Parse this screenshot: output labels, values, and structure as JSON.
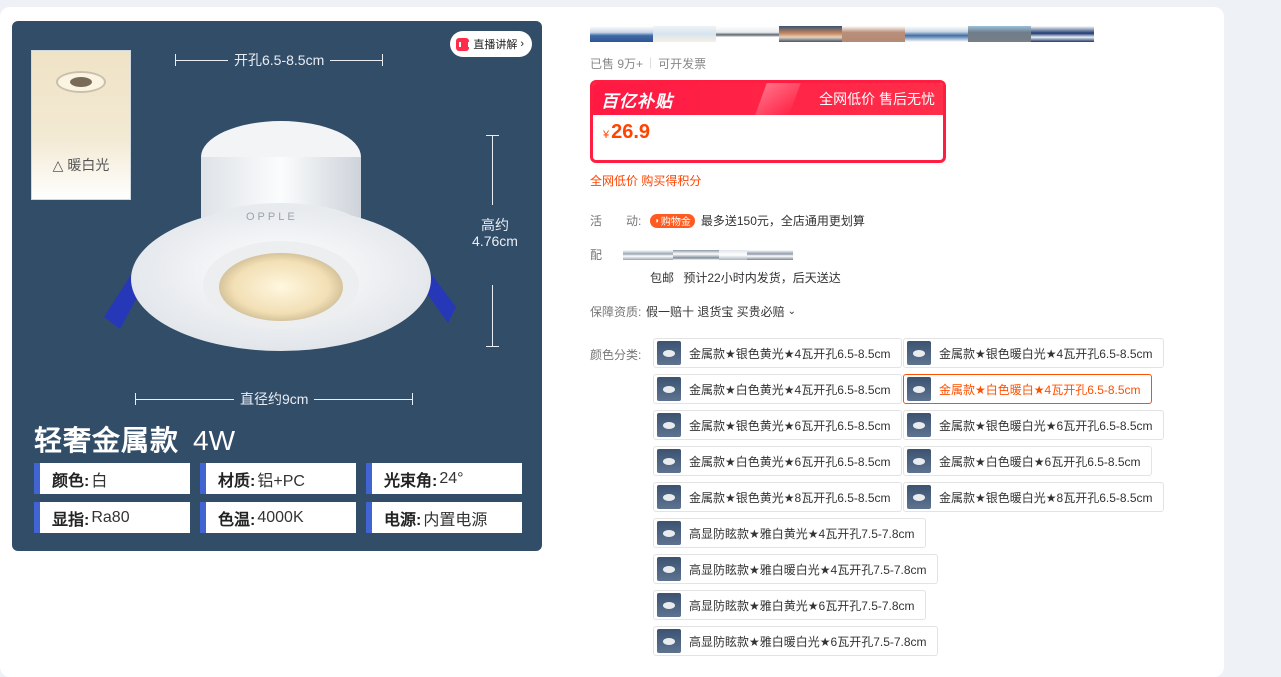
{
  "hero": {
    "live_label": "直播讲解",
    "dim_top": "开孔6.5-8.5cm",
    "dim_height": "高约\n4.76cm",
    "dim_bottom": "直径约9cm",
    "light_swatch_label": "△ 暖白光",
    "title": "轻奢金属款",
    "power": "4W",
    "specs": [
      {
        "key": "颜色:",
        "value": "白"
      },
      {
        "key": "材质:",
        "value": "铝+PC"
      },
      {
        "key": "光束角:",
        "value": "24°"
      },
      {
        "key": "显指:",
        "value": "Ra80"
      },
      {
        "key": "色温:",
        "value": "4000K"
      },
      {
        "key": "电源:",
        "value": "内置电源"
      }
    ],
    "brand_mark": "OPPLE"
  },
  "info": {
    "sold": "已售 9万+",
    "invoice": "可开发票",
    "price_banner": "百亿补贴",
    "price_slogan": "全网低价 售后无忧",
    "currency": "¥",
    "price": "26.9",
    "promo": "全网低价 购买得积分",
    "activity_label": "活　　动:",
    "activity_tag": "购物金",
    "activity_text": "最多送150元，全店通用更划算",
    "delivery_label": "配",
    "ship_free": "包邮",
    "ship_time": "预计22小时内发货，后天送达",
    "guarantee_label": "保障资质:",
    "guarantee_text": "假一赔十 退货宝 买贵必赔",
    "color_label": "颜色分类:",
    "options": [
      "金属款★银色黄光★4瓦开孔6.5-8.5cm",
      "金属款★银色暖白光★4瓦开孔6.5-8.5cm",
      "金属款★白色黄光★4瓦开孔6.5-8.5cm",
      "金属款★白色暖白★4瓦开孔6.5-8.5cm",
      "金属款★银色黄光★6瓦开孔6.5-8.5cm",
      "金属款★银色暖白光★6瓦开孔6.5-8.5cm",
      "金属款★白色黄光★6瓦开孔6.5-8.5cm",
      "金属款★白色暖白★6瓦开孔6.5-8.5cm",
      "金属款★银色黄光★8瓦开孔6.5-8.5cm",
      "金属款★银色暖白光★8瓦开孔6.5-8.5cm",
      "高显防眩款★雅白黄光★4瓦开孔7.5-7.8cm",
      "高显防眩款★雅白暖白光★4瓦开孔7.5-7.8cm",
      "高显防眩款★雅白黄光★6瓦开孔7.5-7.8cm",
      "高显防眩款★雅白暖白光★6瓦开孔7.5-7.8cm"
    ],
    "selected_option": 3
  },
  "colors": {
    "hero_bg": "#324d68",
    "accent_red": "#ff1e42",
    "price_orange": "#ff4400",
    "spec_bar": "#4164d3"
  }
}
